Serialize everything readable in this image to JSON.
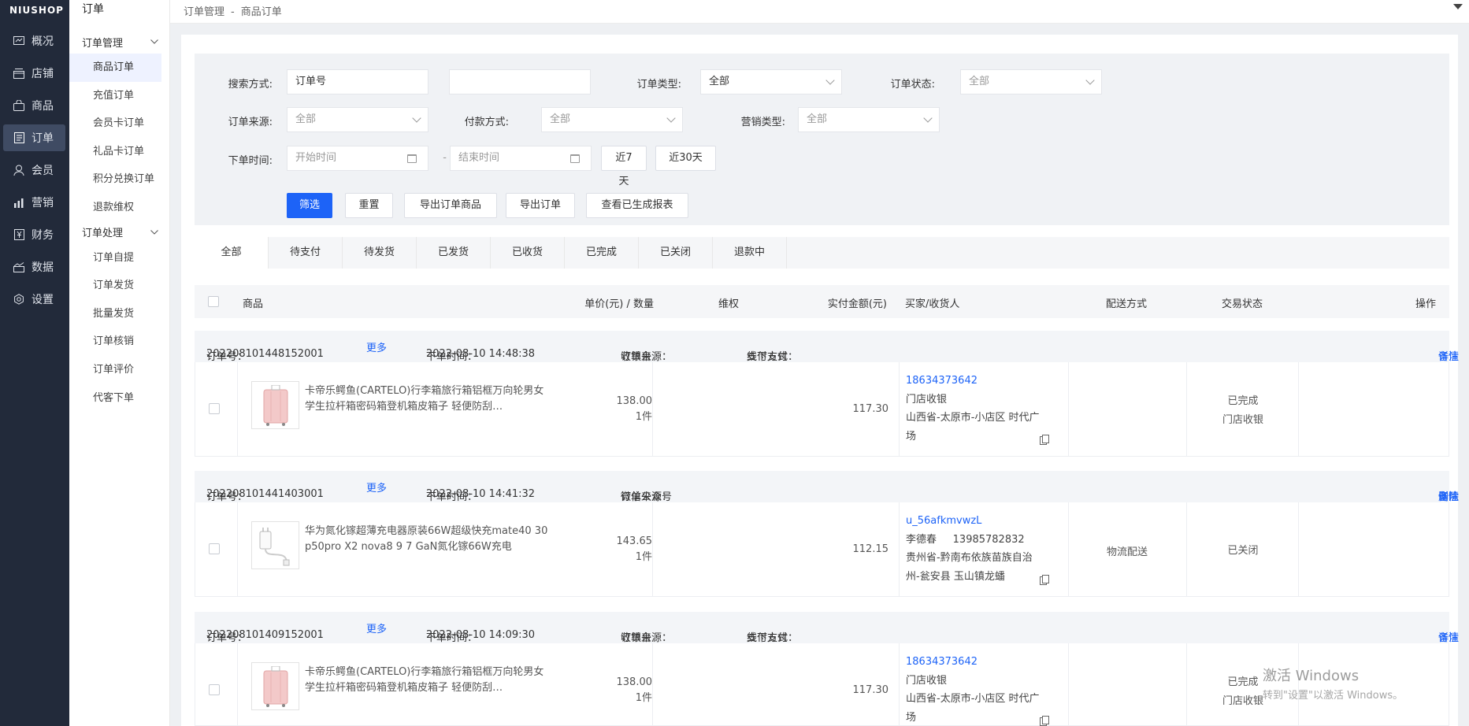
{
  "nav": {
    "logo": "NIUSHOP",
    "items": [
      {
        "label": "概况",
        "icon": "overview-icon"
      },
      {
        "label": "店铺",
        "icon": "shop-icon"
      },
      {
        "label": "商品",
        "icon": "goods-icon"
      },
      {
        "label": "订单",
        "icon": "order-icon"
      },
      {
        "label": "会员",
        "icon": "member-icon"
      },
      {
        "label": "营销",
        "icon": "marketing-icon"
      },
      {
        "label": "财务",
        "icon": "finance-icon"
      },
      {
        "label": "数据",
        "icon": "data-icon"
      },
      {
        "label": "设置",
        "icon": "settings-icon"
      }
    ]
  },
  "submenu": {
    "title": "订单",
    "group1": "订单管理",
    "group1_items": [
      "商品订单",
      "充值订单",
      "会员卡订单",
      "礼品卡订单",
      "积分兑换订单",
      "退款维权"
    ],
    "group2": "订单处理",
    "group2_items": [
      "订单自提",
      "订单发货",
      "批量发货",
      "订单核销",
      "订单评价",
      "代客下单"
    ]
  },
  "breadcrumb": {
    "parent": "订单管理",
    "sep": "-",
    "current": "商品订单"
  },
  "filter": {
    "search_label": "搜索方式:",
    "search_value": "订单号",
    "type_label": "订单类型:",
    "type_value": "全部",
    "status_label": "订单状态:",
    "status_value": "全部",
    "source_label": "订单来源:",
    "source_value": "全部",
    "pay_label": "付款方式:",
    "pay_value": "全部",
    "marketing_label": "营销类型:",
    "marketing_value": "全部",
    "time_label": "下单时间:",
    "start_placeholder": "开始时间",
    "dash": "-",
    "end_placeholder": "结束时间",
    "last7": "近7天",
    "last30": "近30天",
    "btn_filter": "筛选",
    "btn_reset": "重置",
    "btn_export_goods": "导出订单商品",
    "btn_export_order": "导出订单",
    "btn_view_report": "查看已生成报表"
  },
  "tabs": [
    "全部",
    "待支付",
    "待发货",
    "已发货",
    "已收货",
    "已完成",
    "已关闭",
    "退款中"
  ],
  "table_header": {
    "goods": "商品",
    "price_qty": "单价(元) / 数量",
    "rights": "维权",
    "paid": "实付金额(元)",
    "buyer": "买家/收货人",
    "delivery": "配送方式",
    "trade_status": "交易状态",
    "action": "操作"
  },
  "orders": [
    {
      "order_no_label": "订单号：",
      "order_no": "202208101448152001",
      "more": "更多",
      "time_label": "下单时间：",
      "time": "2022-08-10 14:48:38",
      "source_label": "订单来源：",
      "source": "收银台",
      "pay_label": "支付方式：",
      "pay": "线下支付",
      "actions": [
        "详情",
        "备注"
      ],
      "product": "卡帝乐鳄鱼(CARTELO)行李箱旅行箱铝框万向轮男女学生拉杆箱密码箱登机箱皮箱子 轻便防刮…",
      "price": "138.00",
      "qty": "1件",
      "paid": "117.30",
      "buyer_id": "18634373642",
      "buyer_line2": "门店收银",
      "buyer_line3": "山西省-太原市-小店区 时代广",
      "buyer_line4": "场",
      "delivery": "",
      "status1": "已完成",
      "status2": "门店收银"
    },
    {
      "order_no_label": "订单号：",
      "order_no": "202208101441403001",
      "more": "更多",
      "time_label": "下单时间：",
      "time": "2022-08-10 14:41:32",
      "source_label": "订单来源：",
      "source": "微信公众号",
      "pay_label": "",
      "pay": "",
      "actions": [
        "详情",
        "删除",
        "备注"
      ],
      "product": "华为氮化镓超薄充电器原装66W超级快充mate40 30 p50pro X2 nova8 9 7 GaN氮化镓66W充电",
      "price": "143.65",
      "qty": "1件",
      "paid": "112.15",
      "buyer_id": "u_56afkmvwzL",
      "buyer_line2": "李德春     13985782832",
      "buyer_line3": "贵州省-黔南布依族苗族自治",
      "buyer_line4": "州-瓮安县 玉山镇龙蟠",
      "delivery": "物流配送",
      "status1": "已关闭",
      "status2": ""
    },
    {
      "order_no_label": "订单号：",
      "order_no": "202208101409152001",
      "more": "更多",
      "time_label": "下单时间：",
      "time": "2022-08-10 14:09:30",
      "source_label": "订单来源：",
      "source": "收银台",
      "pay_label": "支付方式：",
      "pay": "线下支付",
      "actions": [
        "详情",
        "备注"
      ],
      "product": "卡帝乐鳄鱼(CARTELO)行李箱旅行箱铝框万向轮男女学生拉杆箱密码箱登机箱皮箱子 轻便防刮…",
      "price": "138.00",
      "qty": "1件",
      "paid": "117.30",
      "buyer_id": "18634373642",
      "buyer_line2": "门店收银",
      "buyer_line3": "山西省-太原市-小店区 时代广",
      "buyer_line4": "场",
      "delivery": "",
      "status1": "已完成",
      "status2": "门店收银"
    }
  ],
  "windows_watermark": {
    "line1": "激活 Windows",
    "line2": "转到\"设置\"以激活 Windows。"
  },
  "colors": {
    "nav_bg": "#222a3a",
    "primary": "#1d63f7",
    "link": "#1d63f7"
  }
}
